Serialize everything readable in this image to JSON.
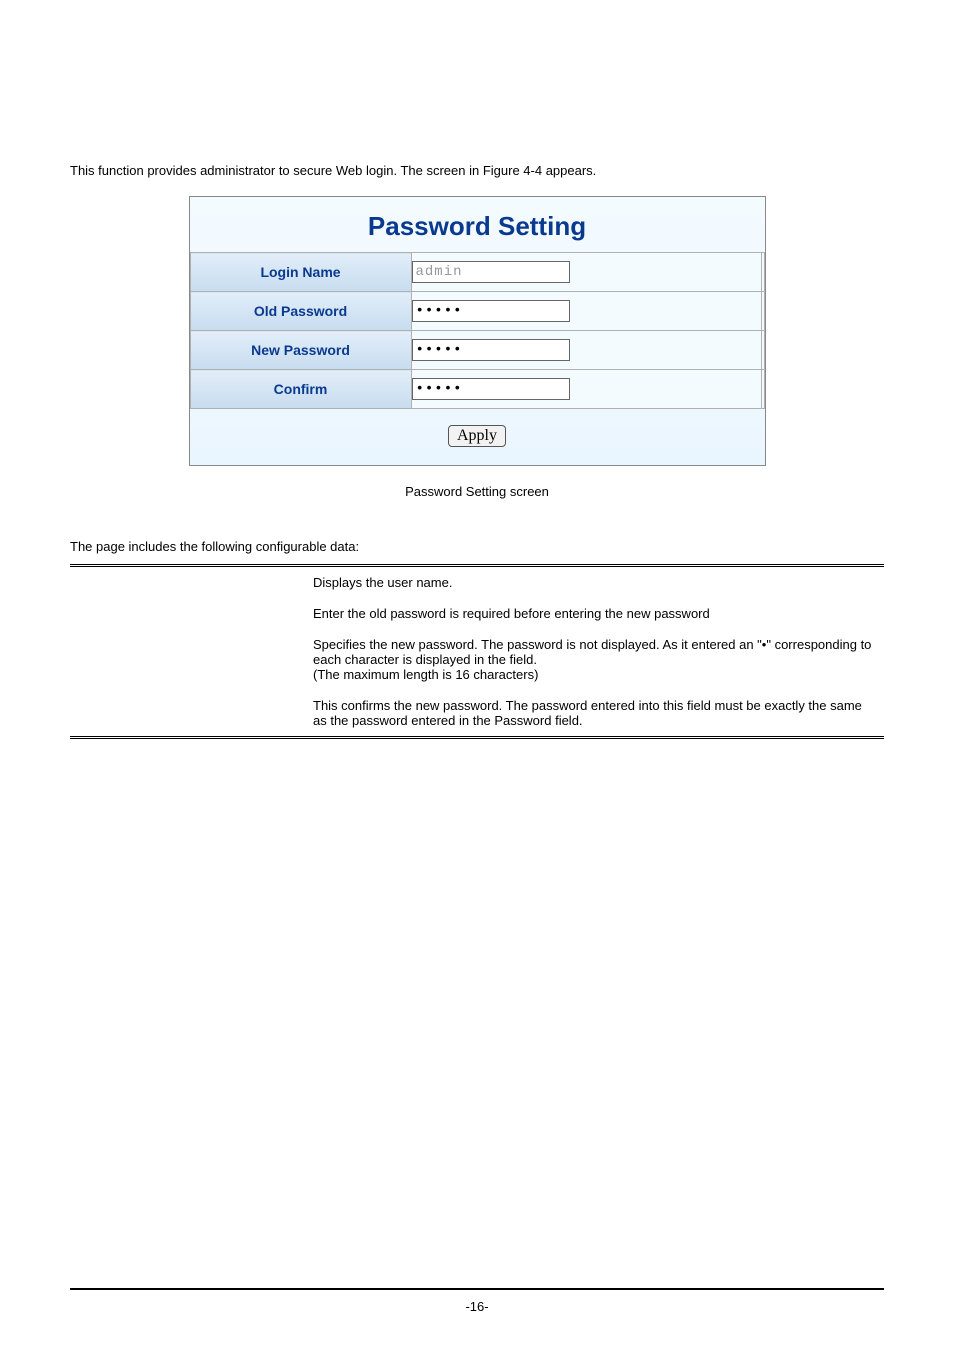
{
  "intro": "This function provides administrator to secure Web login. The screen in Figure 4-4 appears.",
  "panel": {
    "title": "Password Setting",
    "rows": [
      {
        "label": "Login Name",
        "value": "admin",
        "type": "text",
        "disabled": true
      },
      {
        "label": "Old Password",
        "value": "•••••",
        "type": "password",
        "disabled": false
      },
      {
        "label": "New Password",
        "value": "•••••",
        "type": "password",
        "disabled": false
      },
      {
        "label": "Confirm",
        "value": "•••••",
        "type": "password",
        "disabled": false
      }
    ],
    "apply_label": "Apply"
  },
  "caption": "Password Setting screen",
  "subhead": "The page includes the following configurable data:",
  "descriptions": [
    "Displays the user name.",
    "Enter the old password is required before entering the new password",
    "Specifies the new password. The password is not displayed. As it entered an \"•\" corresponding to each character is displayed in the field.",
    "(The maximum length is 16 characters)",
    "This confirms the new password. The password entered into this field must be exactly the same as the password entered in the Password field."
  ],
  "page_number": "-16-"
}
